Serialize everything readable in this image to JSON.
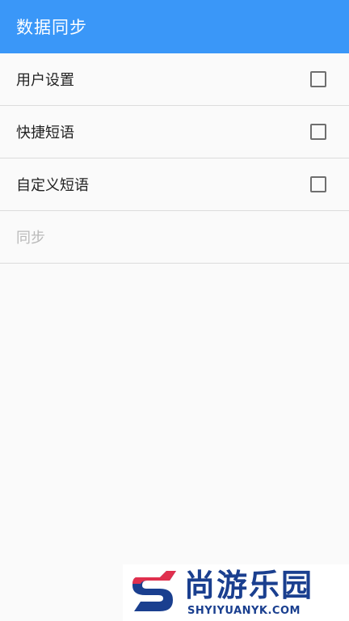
{
  "appbar": {
    "title": "数据同步",
    "color": "#3a97f8"
  },
  "items": [
    {
      "label": "用户设置",
      "checked": false
    },
    {
      "label": "快捷短语",
      "checked": false
    },
    {
      "label": "自定义短语",
      "checked": false
    }
  ],
  "sync": {
    "label": "同步",
    "enabled": false
  },
  "watermark": {
    "brand_cn": "尚游乐园",
    "brand_en": "SHYIYUANYK.COM",
    "logo_icon": "s-logo-icon"
  }
}
